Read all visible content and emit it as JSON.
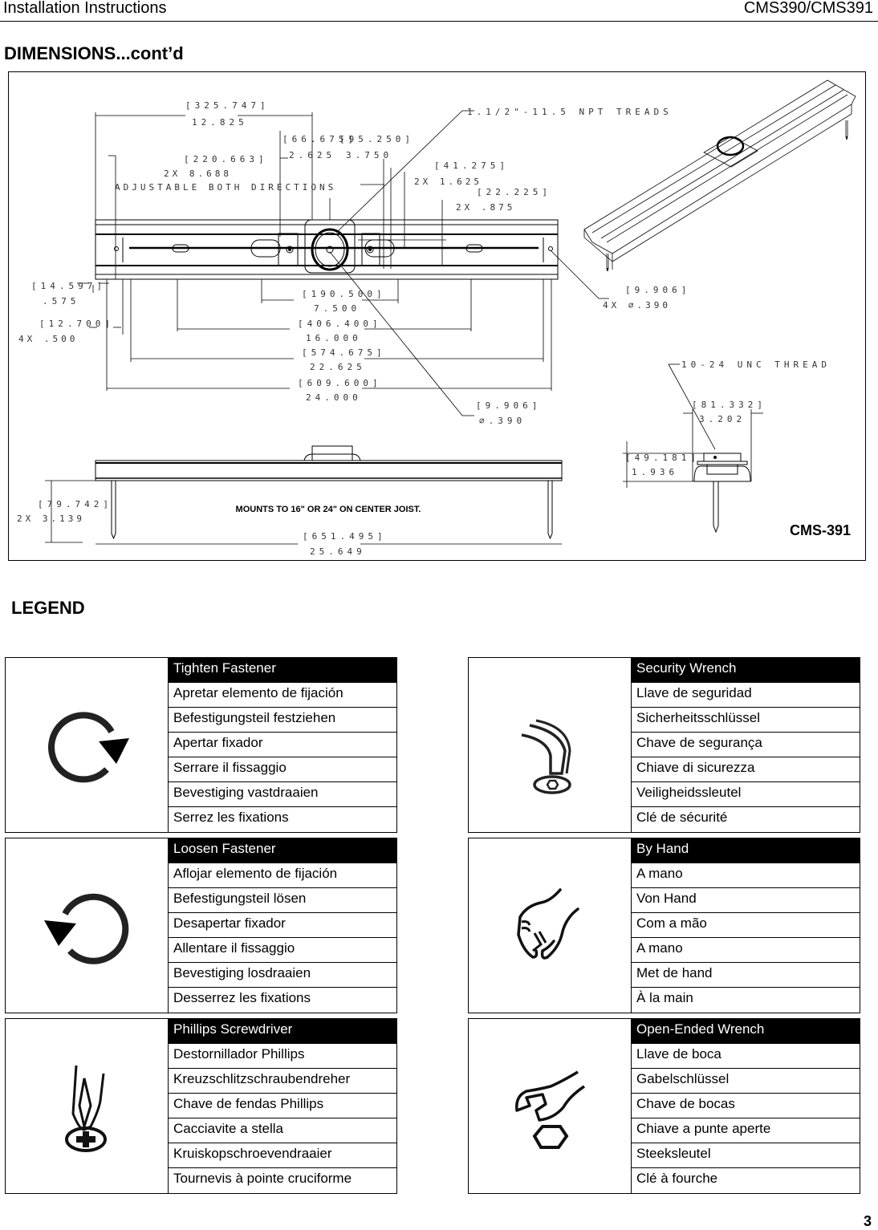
{
  "header": {
    "left": "Installation Instructions",
    "right": "CMS390/CMS391"
  },
  "section_title": "DIMENSIONS...cont’d",
  "drawing": {
    "model_label": "CMS-391",
    "mount_note": "MOUNTS TO 16\" OR 24\" ON CENTER JOIST.",
    "callouts": {
      "npt_thread": "1.1/2\"-11.5 NPT TREADS",
      "unc_thread": "10-24 UNC THREAD",
      "adjustable": "ADJUSTABLE BOTH DIRECTIONS"
    },
    "dimensions": {
      "overall_top": {
        "mm": "[325.747]",
        "in": "12.825"
      },
      "adjust": {
        "mm": "[220.663]",
        "in": "2X   8.688"
      },
      "center_plate_left": {
        "mm": "[66.675]",
        "in": "2.625"
      },
      "center_plate_right": {
        "mm": "[95.250]",
        "in": "3.750"
      },
      "slot_width": {
        "mm": "[41.275]",
        "in": "2X   1.625"
      },
      "slot_height": {
        "mm": "[22.225]",
        "in": "2X    .875"
      },
      "end_offset": {
        "mm": "[14.597]",
        "in": ".575"
      },
      "hole_offset": {
        "mm": "[12.700]",
        "in": "4X    .500"
      },
      "d190": {
        "mm": "[190.500]",
        "in": "7.500"
      },
      "d406": {
        "mm": "[406.400]",
        "in": "16.000"
      },
      "d574": {
        "mm": "[574.675]",
        "in": "22.625"
      },
      "d609": {
        "mm": "[609.600]",
        "in": "24.000"
      },
      "hole_4x": {
        "mm": "[9.906]",
        "in": "4X   ∅.390"
      },
      "hole_center": {
        "mm": "[9.906]",
        "in": "∅.390"
      },
      "side_width": {
        "mm": "[81.332]",
        "in": "3.202"
      },
      "side_height": {
        "mm": "[49.181]",
        "in": "1.936"
      },
      "leg_length": {
        "mm": "[79.742]",
        "in": "2X   3.139"
      },
      "overall_bottom": {
        "mm": "[651.495]",
        "in": "25.649"
      }
    }
  },
  "legend": {
    "title": "LEGEND",
    "items": [
      {
        "icon": "tighten-fastener-icon",
        "title": "Tighten Fastener",
        "translations": [
          "Apretar elemento de fijación",
          "Befestigungsteil festziehen",
          "Apertar fixador",
          "Serrare il fissaggio",
          "Bevestiging vastdraaien",
          "Serrez les fixations"
        ]
      },
      {
        "icon": "security-wrench-icon",
        "title": "Security Wrench",
        "translations": [
          "Llave de seguridad",
          "Sicherheitsschlüssel",
          "Chave de segurança",
          "Chiave di sicurezza",
          "Veiligheidssleutel",
          "Clé de sécurité"
        ]
      },
      {
        "icon": "loosen-fastener-icon",
        "title": "Loosen Fastener",
        "translations": [
          "Aflojar elemento de fijación",
          "Befestigungsteil lösen",
          "Desapertar fixador",
          "Allentare il fissaggio",
          "Bevestiging losdraaien",
          "Desserrez les fixations"
        ]
      },
      {
        "icon": "by-hand-icon",
        "title": "By Hand",
        "translations": [
          "A mano",
          "Von Hand",
          "Com a mão",
          "A mano",
          "Met de hand",
          "À la main"
        ]
      },
      {
        "icon": "phillips-screwdriver-icon",
        "title": "Phillips Screwdriver",
        "translations": [
          "Destornillador Phillips",
          "Kreuzschlitzschraubendreher",
          "Chave de fendas Phillips",
          "Cacciavite a stella",
          "Kruiskopschroevendraaier",
          "Tournevis à pointe cruciforme"
        ]
      },
      {
        "icon": "open-ended-wrench-icon",
        "title": "Open-Ended Wrench",
        "translations": [
          "Llave de boca",
          "Gabelschlüssel",
          "Chave de bocas",
          "Chiave a punte aperte",
          "Steeksleutel",
          "Clé à fourche"
        ]
      }
    ]
  },
  "page_number": "3"
}
